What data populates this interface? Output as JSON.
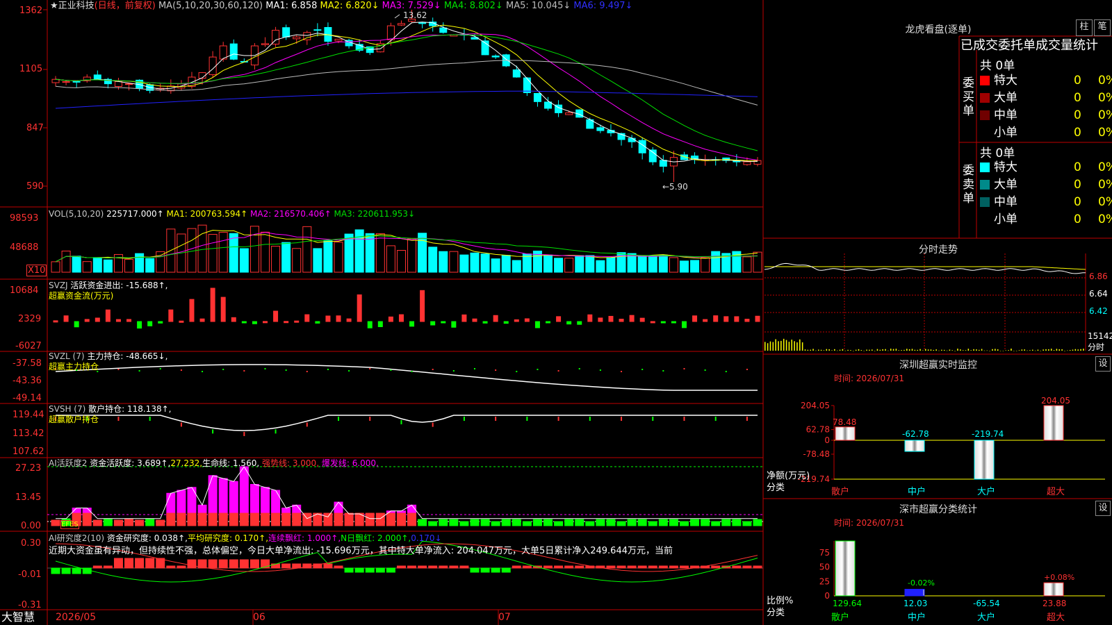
{
  "colors": {
    "up": "#ff3232",
    "down": "#00ffff",
    "ma1": "#ffffff",
    "ma2": "#ffff00",
    "ma3": "#ff00ff",
    "ma4": "#00e000",
    "ma5": "#bbbbbb",
    "ma6": "#2222ff",
    "yellow": "#ffff00",
    "green": "#00ff00",
    "magenta": "#ff00ff",
    "grid": "#c00000"
  },
  "main": {
    "star_title": "★正业科技",
    "period": "(日线，前复权)",
    "ma_def": "MA(5,10,20,30,60,120)",
    "ma1": "MA1: 6.858",
    "ma2": "MA2: 6.820↓",
    "ma3": "MA3: 7.529↓",
    "ma4": "MA4: 8.802↓",
    "ma5": "MA5: 10.045↓",
    "ma6": "MA6: 9.497↓",
    "yticks": [
      "1362",
      "1105",
      "847",
      "590"
    ],
    "high_label": "13.62",
    "low_label": "←5.90"
  },
  "vol": {
    "def": "VOL(5,10,20)",
    "value": "225717.000↑",
    "ma1": "MA1: 200763.594↑",
    "ma2": "MA2: 216570.406↑",
    "ma3": "MA3: 220611.953↓",
    "yticks": [
      "98593",
      "48688"
    ],
    "unit": "X10"
  },
  "svzj": {
    "def": "SVZJ",
    "label": "活跃资金进出: -15.688↑,",
    "sub": "超赢资金流(万元)",
    "yticks": [
      "10684",
      "2329",
      "-6027"
    ]
  },
  "svzl": {
    "def": "SVZL (7)",
    "label": "主力持仓: -48.665↓,",
    "sub": "超赢主力持仓",
    "yticks": [
      "-37.58",
      "-43.36",
      "-49.14"
    ]
  },
  "svsh": {
    "def": "SVSH (7)",
    "label": "散户持仓: 118.138↑,",
    "sub": "超赢散户持仓",
    "yticks": [
      "119.44",
      "113.42",
      "107.62"
    ]
  },
  "ai1": {
    "def": "AI活跃度2",
    "label1": "资金活跃度: 3.689↑,",
    "label2": "27.232,",
    "label3": "生命线: 1.560,",
    "label4": "强势线: 3.000,",
    "label5": "爆发线: 6.000,",
    "yticks": [
      "27.23",
      "13.45",
      "0.00"
    ],
    "tag": "EFES"
  },
  "ai2": {
    "def": "AI研究度2(10)",
    "label1": "资金研究度: 0.038↑,",
    "label2": "平均研究度: 0.170↑,",
    "label3": "连续飘红: 1.000↑,",
    "label4": "N日飘红: 2.000↑,",
    "label5": "0.170↓",
    "yticks": [
      "0.30",
      "-0.01",
      "-0.31"
    ],
    "comment": "近期大资金虽有异动，但持续性不强，总体偏空，今日大单净流出: -15.696万元，其中特大单净流入: 204.047万元，大单5日累计净入249.644万元，当前"
  },
  "bottom": {
    "brand": "大智慧",
    "dates": [
      "2026/05",
      "06",
      "07"
    ]
  },
  "lhb": {
    "title": "龙虎看盘(逐单)",
    "btn1": "柱",
    "btn2": "笔",
    "tabs": "已成交委托单成交量统计",
    "buy_side": "委买单",
    "sell_side": "委卖单",
    "buy_total": "共 0单",
    "sell_total": "共 0单",
    "rows": [
      {
        "name": "特大",
        "count": "0",
        "pct": "0%"
      },
      {
        "name": "大单",
        "count": "0",
        "pct": "0%"
      },
      {
        "name": "中单",
        "count": "0",
        "pct": "0%"
      },
      {
        "name": "小单",
        "count": "0",
        "pct": "0%"
      }
    ],
    "sell_rows": [
      {
        "name": "特大",
        "count": "0",
        "pct": "0%"
      },
      {
        "name": "大单",
        "count": "0",
        "pct": "0%"
      },
      {
        "name": "中单",
        "count": "0",
        "pct": "0%"
      },
      {
        "name": "小单",
        "count": "0",
        "pct": "0%"
      }
    ]
  },
  "intraday": {
    "title": "分时走势",
    "yticks": [
      "6.86",
      "6.64",
      "6.42"
    ],
    "vol": "15142",
    "unit": "分时"
  },
  "realtime": {
    "title": "深圳超赢实时监控",
    "btn": "设",
    "time": "时间: 2026/07/31",
    "yticks": [
      "204.05",
      "62.78",
      "0",
      "-78.48",
      "-219.74"
    ],
    "ylabel1": "净额(万元)",
    "ylabel2": "分类",
    "cats": [
      "散户",
      "中户",
      "大户",
      "超大"
    ],
    "values": [
      78.48,
      -62.78,
      -219.74,
      204.05
    ],
    "value_labels": [
      "78.48",
      "-62.78",
      "-219.74",
      "204.05"
    ]
  },
  "classify": {
    "title": "深市超赢分类统计",
    "btn": "设",
    "time": "时间: 2026/07/31",
    "yticks": [
      "75",
      "50",
      "25",
      "0"
    ],
    "ylabel1": "比例%",
    "ylabel2": "分类",
    "cats": [
      "散户",
      "中户",
      "大户",
      "超大"
    ],
    "pct": [
      129.64,
      12.03,
      -65.54,
      23.88
    ],
    "pct_labels": [
      "129.64",
      "12.03",
      "-65.54",
      "23.88"
    ],
    "extra": [
      "-0.02%",
      "+0.08%"
    ]
  },
  "chart_data": [
    {
      "type": "candlestick",
      "title": "正业科技 日线",
      "ylim": [
        5.9,
        13.62
      ],
      "x": [
        "2026/05",
        "06",
        "07"
      ],
      "close": [
        10.5,
        10.4,
        10.4,
        10.6,
        10.5,
        10.3,
        10.4,
        10.3,
        10.1,
        10.0,
        10.1,
        10.2,
        10.3,
        10.6,
        10.8,
        11.5,
        12.0,
        11.4,
        11.3,
        12.0,
        12.1,
        12.7,
        12.4,
        12.4,
        12.6,
        12.7,
        12.2,
        12.3,
        12.0,
        11.8,
        11.7,
        12.1,
        12.9,
        13.0,
        13.2,
        13.0,
        12.9,
        12.6,
        12.5,
        12.5,
        12.3,
        11.6,
        11.5,
        11.1,
        10.6,
        9.9,
        9.5,
        9.2,
        9.0,
        9.0,
        8.8,
        8.3,
        8.2,
        8.1,
        7.8,
        7.7,
        7.2,
        6.8,
        6.6,
        7.0,
        6.9,
        6.9,
        6.9,
        6.9,
        6.86,
        6.8,
        6.8,
        6.86
      ]
    },
    {
      "type": "bar",
      "title": "VOL",
      "ylabel": "X10",
      "ylim": [
        0,
        98593
      ]
    },
    {
      "type": "bar",
      "title": "深圳超赢实时监控",
      "categories": [
        "散户",
        "中户",
        "大户",
        "超大"
      ],
      "values": [
        78.48,
        -62.78,
        -219.74,
        204.05
      ],
      "ylim": [
        -219.74,
        204.05
      ]
    },
    {
      "type": "bar",
      "title": "深市超赢分类统计",
      "categories": [
        "散户",
        "中户",
        "大户",
        "超大"
      ],
      "values": [
        129.64,
        12.03,
        -65.54,
        23.88
      ]
    }
  ]
}
